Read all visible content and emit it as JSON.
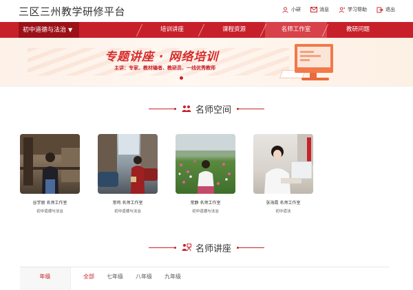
{
  "header": {
    "site_title": "三区三州教学研修平台",
    "links": [
      {
        "label": "小研",
        "icon": "person-icon"
      },
      {
        "label": "消息",
        "icon": "mail-icon"
      },
      {
        "label": "学习帮助",
        "icon": "help-person-icon"
      },
      {
        "label": "退出",
        "icon": "logout-icon"
      }
    ]
  },
  "nav": {
    "subject": "初中道德与法治",
    "items": [
      {
        "label": "培训讲座",
        "active": false
      },
      {
        "label": "课程资源",
        "active": false
      },
      {
        "label": "名师工作室",
        "active": true
      },
      {
        "label": "教研问题",
        "active": false
      }
    ]
  },
  "banner": {
    "title": "专题讲座 · 网络培训",
    "subtitle": "主讲：专家、教材编者、教研员、一线优秀教师"
  },
  "section_teachers": {
    "title": "名师空间"
  },
  "teachers": [
    {
      "name": "谷学丽 名师工作室",
      "subject": "初中道德与法治"
    },
    {
      "name": "常鸣 名师工作室",
      "subject": "初中道德与法治"
    },
    {
      "name": "常静 名师工作室",
      "subject": "初中道德与法治"
    },
    {
      "name": "张海霞 名师工作室",
      "subject": "初中道法"
    }
  ],
  "section_lectures": {
    "title": "名师讲座"
  },
  "filter": {
    "label": "年级",
    "options": [
      "全部",
      "七年级",
      "八年级",
      "九年级"
    ],
    "active": "全部"
  },
  "colors": {
    "brand": "#c8202a",
    "brand_dark": "#9c1118"
  }
}
